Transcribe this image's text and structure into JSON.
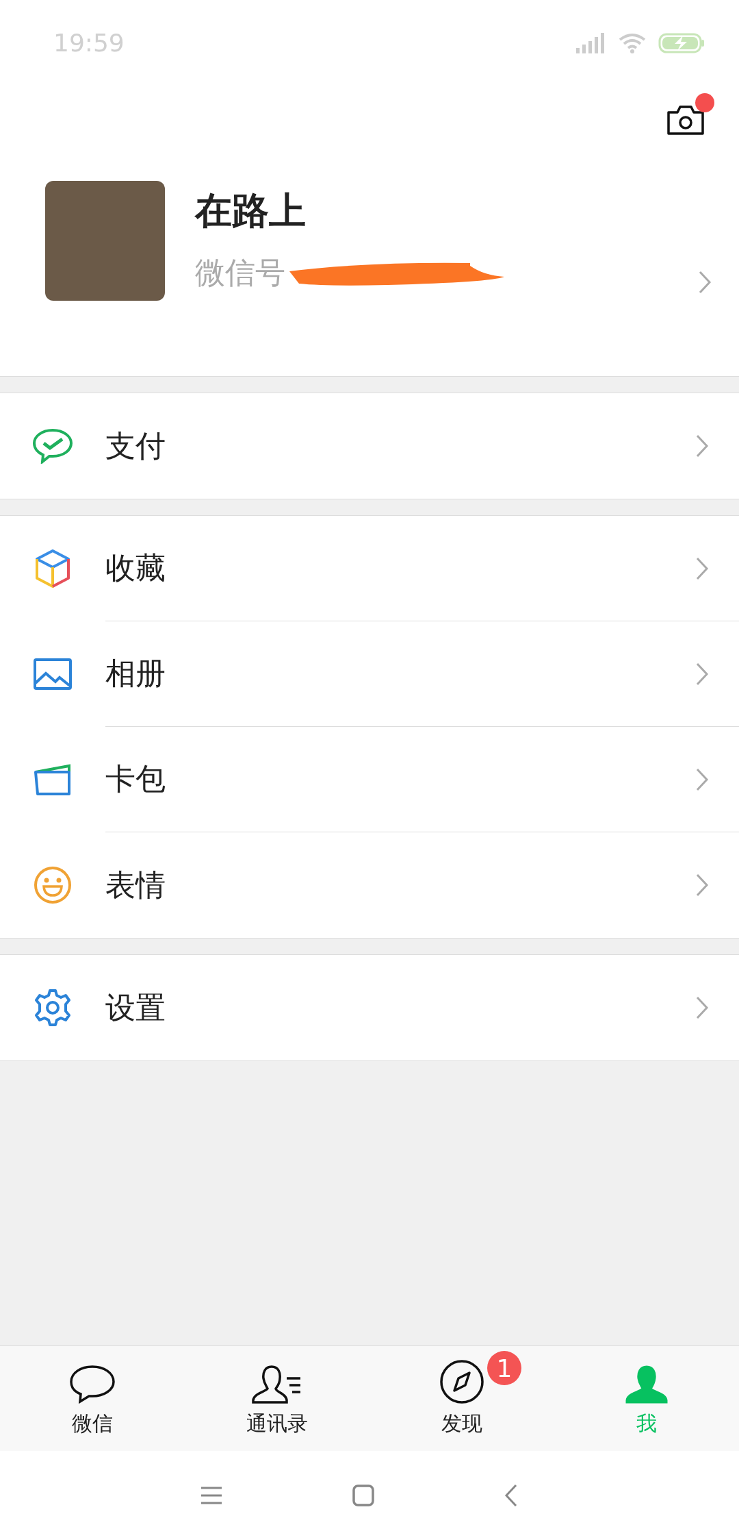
{
  "status_bar": {
    "time": "19:59"
  },
  "camera": {
    "dot": true
  },
  "profile": {
    "name": "在路上",
    "id_label": "微信号",
    "id_redacted": true
  },
  "groups": [
    {
      "items": [
        {
          "kind": "pay",
          "label": "支付"
        }
      ]
    },
    {
      "items": [
        {
          "kind": "favorites",
          "label": "收藏"
        },
        {
          "kind": "album",
          "label": "相册"
        },
        {
          "kind": "cards",
          "label": "卡包"
        },
        {
          "kind": "stickers",
          "label": "表情"
        }
      ]
    },
    {
      "items": [
        {
          "kind": "settings",
          "label": "设置"
        }
      ]
    }
  ],
  "tabs": [
    {
      "kind": "chats",
      "label": "微信",
      "selected": false
    },
    {
      "kind": "contacts",
      "label": "通讯录",
      "selected": false
    },
    {
      "kind": "discover",
      "label": "发现",
      "selected": false,
      "badge": "1"
    },
    {
      "kind": "me",
      "label": "我",
      "selected": true
    }
  ]
}
